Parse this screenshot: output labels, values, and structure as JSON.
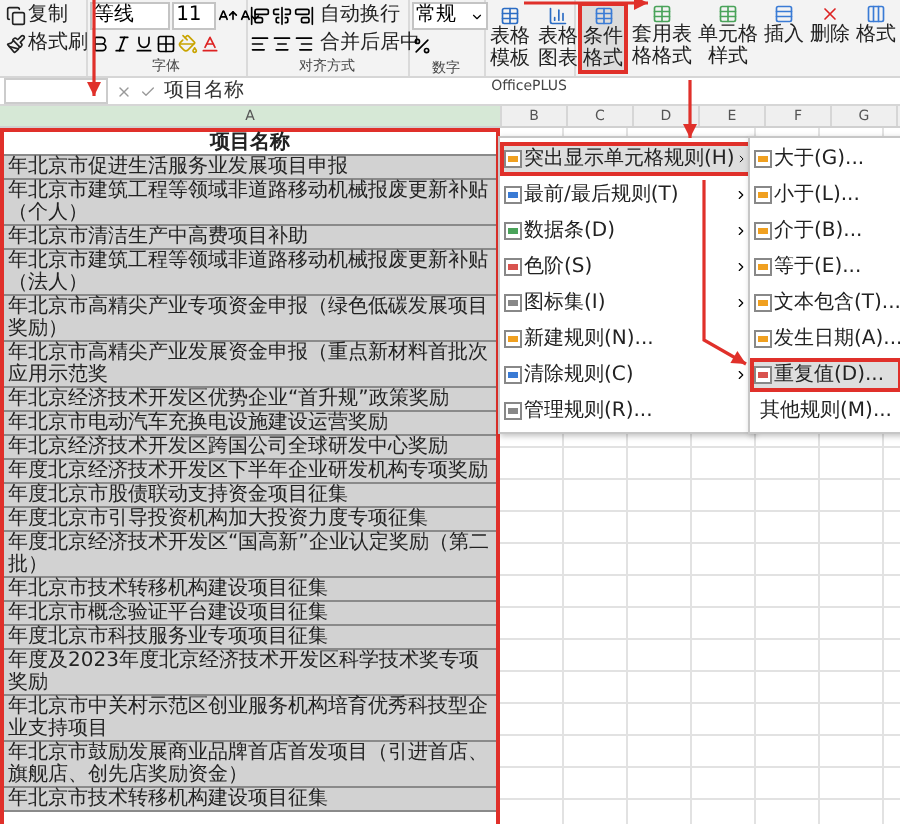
{
  "ribbon": {
    "clipboard": [
      "复制",
      "格式刷"
    ],
    "font": {
      "name": "等线",
      "size": "11",
      "group_label": "字体"
    },
    "alignment": {
      "wrap": "自动换行",
      "merge": "合并后居中",
      "group_label": "对齐方式"
    },
    "number": {
      "format": "常规",
      "group_label": "数字"
    },
    "officeplus": {
      "buttons": [
        "表格模板",
        "表格图表"
      ],
      "group_label": "OfficePLUS"
    },
    "buttons": [
      {
        "label": "条件格式",
        "selected": true
      },
      {
        "label": "套用表格格式",
        "selected": false
      },
      {
        "label": "单元格样式",
        "selected": false
      },
      {
        "label": "插入",
        "selected": false
      },
      {
        "label": "删除",
        "selected": false
      },
      {
        "label": "格式",
        "selected": false
      }
    ]
  },
  "formula_bar": {
    "value": "项目名称"
  },
  "sheet": {
    "columns": [
      "A",
      "B",
      "C",
      "D",
      "E",
      "F",
      "G"
    ],
    "title_cell": "项目名称",
    "rows": [
      {
        "text": "年北京市促进生活服务业发展项目申报",
        "selected": true
      },
      {
        "text": "年北京市建筑工程等领域非道路移动机械报废更新补贴（个人）",
        "selected": true
      },
      {
        "text": "年北京市清洁生产中高费项目补助",
        "selected": true
      },
      {
        "text": "年北京市建筑工程等领域非道路移动机械报废更新补贴（法人）",
        "selected": true
      },
      {
        "text": "年北京市高精尖产业专项资金申报（绿色低碳发展项目奖励）",
        "selected": true
      },
      {
        "text": "年北京市高精尖产业发展资金申报（重点新材料首批次应用示范奖",
        "selected": true
      },
      {
        "text": "年北京经济技术开发区优势企业“首升规”政策奖励",
        "selected": true
      },
      {
        "text": "年北京市电动汽车充换电设施建设运营奖励",
        "selected": true
      },
      {
        "text": "年北京经济技术开发区跨国公司全球研发中心奖励",
        "selected": true
      },
      {
        "text": "年度北京经济技术开发区下半年企业研发机构专项奖励",
        "selected": true
      },
      {
        "text": "年度北京市股债联动支持资金项目征集",
        "selected": true
      },
      {
        "text": "年度北京市引导投资机构加大投资力度专项征集",
        "selected": true
      },
      {
        "text": "年度北京经济技术开发区“国高新”企业认定奖励（第二批）",
        "selected": true
      },
      {
        "text": "年北京市技术转移机构建设项目征集",
        "selected": true
      },
      {
        "text": "年北京市概念验证平台建设项目征集",
        "selected": true
      },
      {
        "text": "年度北京市科技服务业专项项目征集",
        "selected": true
      },
      {
        "text": "年度及2023年度北京经济技术开发区科学技术奖专项奖励",
        "selected": true
      },
      {
        "text": "年北京市中关村示范区创业服务机构培育优秀科技型企业支持项目",
        "selected": true
      },
      {
        "text": "年北京市鼓励发展商业品牌首店首发项目（引进首店、旗舰店、创先店奖励资金）",
        "selected": true
      },
      {
        "text": "年北京市技术转移机构建设项目征集",
        "selected": true
      }
    ]
  },
  "menu": {
    "items": [
      {
        "label": "突出显示单元格规则(H)",
        "kind": "submenu",
        "selected": true
      },
      {
        "label": "最前/最后规则(T)",
        "kind": "submenu",
        "selected": false
      },
      {
        "label": "数据条(D)",
        "kind": "submenu",
        "selected": false
      },
      {
        "label": "色阶(S)",
        "kind": "submenu",
        "selected": false
      },
      {
        "label": "图标集(I)",
        "kind": "submenu",
        "selected": false
      },
      {
        "label": "新建规则(N)...",
        "kind": "command",
        "selected": false
      },
      {
        "label": "清除规则(C)",
        "kind": "submenu",
        "selected": false
      },
      {
        "label": "管理规则(R)...",
        "kind": "command",
        "selected": false
      }
    ]
  },
  "submenu": {
    "items": [
      {
        "label": "大于(G)...",
        "kind": "rule",
        "selected": false
      },
      {
        "label": "小于(L)...",
        "kind": "rule",
        "selected": false
      },
      {
        "label": "介于(B)...",
        "kind": "rule",
        "selected": false
      },
      {
        "label": "等于(E)...",
        "kind": "rule",
        "selected": false
      },
      {
        "label": "文本包含(T)...",
        "kind": "rule",
        "selected": false
      },
      {
        "label": "发生日期(A)...",
        "kind": "rule",
        "selected": false
      },
      {
        "label": "重复值(D)...",
        "kind": "rule",
        "selected": true
      },
      {
        "label": "其他规则(M)...",
        "kind": "more",
        "selected": false
      }
    ]
  }
}
